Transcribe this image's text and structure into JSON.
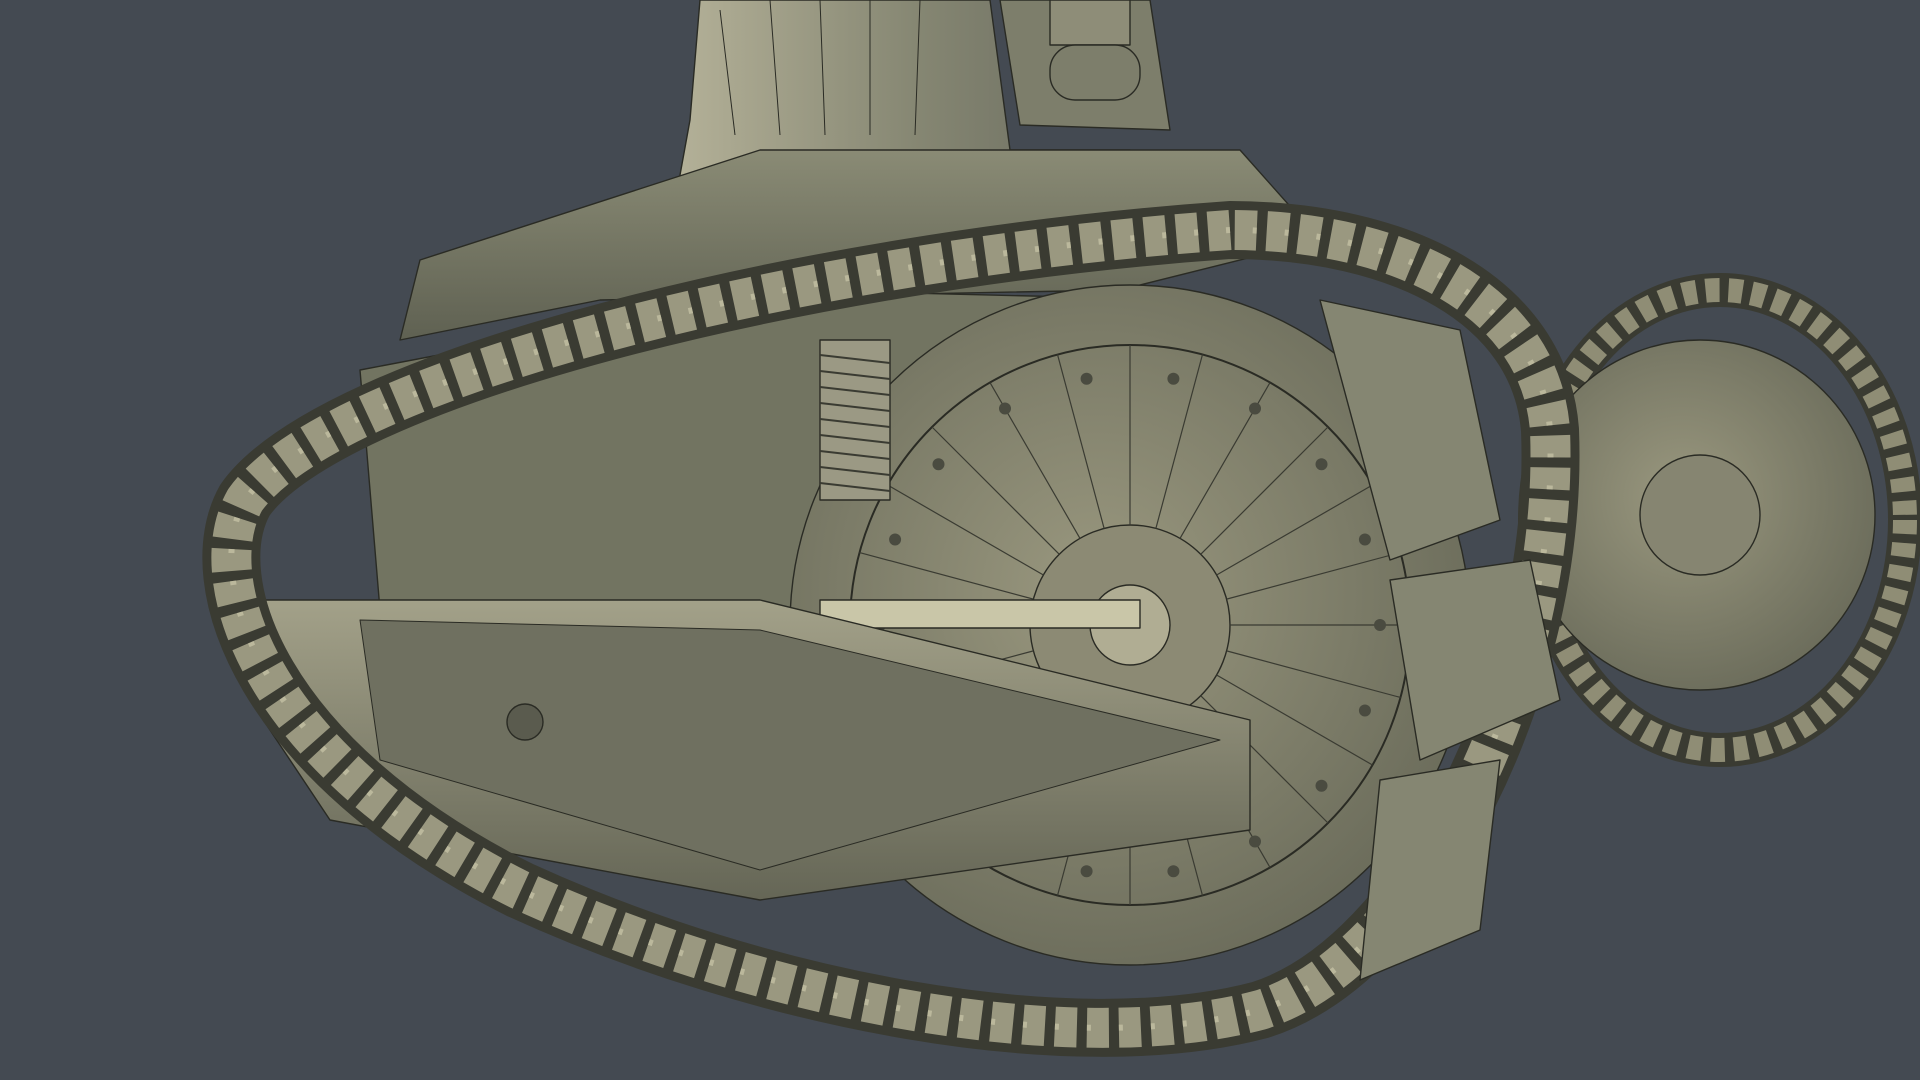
{
  "scene": {
    "background_color": "#444a52",
    "model": {
      "subject": "tank",
      "render_style": "wireframe-shaded",
      "base_color": "#7a7c68",
      "highlight_color": "#c9c6a8",
      "shadow_color": "#4e5046",
      "wire_color": "#2a2b24"
    }
  }
}
